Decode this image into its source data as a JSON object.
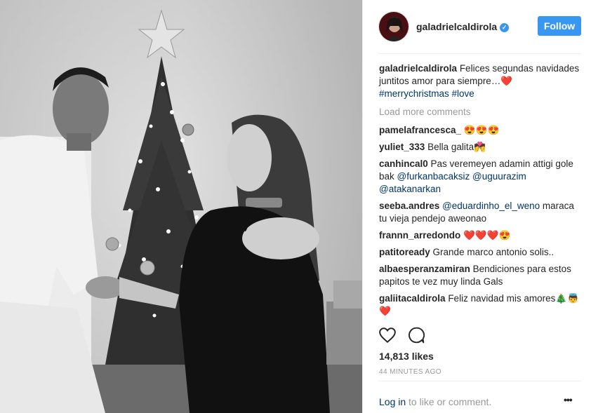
{
  "post": {
    "username": "galadrielcaldirola",
    "verified_icon": "verified-badge-icon",
    "follow_label": "Follow",
    "caption": {
      "username": "galadrielcaldirola",
      "text": "Felices segundas navidades juntitos amor para siempre…❤️",
      "hashtags": "#merrychristmas #love"
    },
    "load_more_label": "Load more comments",
    "comments": [
      {
        "user": "pamelafrancesca_",
        "text": "😍😍😍",
        "tag": ""
      },
      {
        "user": "yuliet_333",
        "text": "Bella galita💏",
        "tag": ""
      },
      {
        "user": "canhincal0",
        "text": "Pas veremeyen adamin attigi gole bak",
        "tag": "@furkanbacaksiz @uguurazim @atakanarkan"
      },
      {
        "user": "seeba.andres",
        "text": "maraca tu vieja pendejo aweonao",
        "tag": "@eduardinho_el_weno"
      },
      {
        "user": "frannn_arredondo",
        "text": "❤️❤️❤️😍",
        "tag": ""
      },
      {
        "user": "patitoready",
        "text": "Grande marco antonio solis..",
        "tag": ""
      },
      {
        "user": "albaesperanzamiran",
        "text": "Bendiciones para estos papitos te vez muy linda Gals",
        "tag": ""
      },
      {
        "user": "galiitacaldirola",
        "text": "Feliz navidad mis amores🎄👼❤️",
        "tag": ""
      }
    ],
    "like_icon": "heart-icon",
    "comment_icon": "comment-bubble-icon",
    "likes": "14,813 likes",
    "time": "44 MINUTES AGO",
    "login_label": "Log in",
    "login_suffix": " to like or comment.",
    "more_label": "•••",
    "colors": {
      "accent": "#3897f0",
      "link": "#003569",
      "muted": "#999999"
    }
  }
}
